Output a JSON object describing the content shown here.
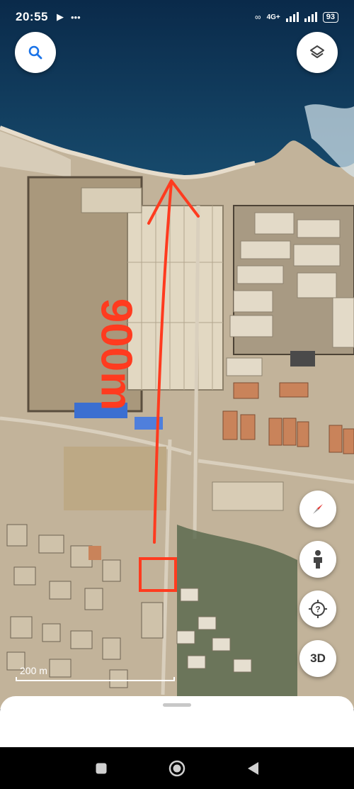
{
  "status_bar": {
    "time": "20:55",
    "left_icons": [
      "play-icon",
      "more-dots-icon"
    ],
    "network": "4G+",
    "battery": "93"
  },
  "map": {
    "annotation_text": "900m",
    "scale_label": "200 m",
    "colors": {
      "annotation": "#ff3b1f",
      "sea": "#0c2f52",
      "sand": "#c9bca6"
    }
  },
  "buttons": {
    "three_d": "3D"
  },
  "icons": {
    "search": "search-icon",
    "layers": "layers-icon",
    "compass": "compass-icon",
    "street_view": "street-view-person-icon",
    "help": "help-location-icon"
  },
  "nav": [
    "recents-button",
    "home-button",
    "back-button"
  ]
}
